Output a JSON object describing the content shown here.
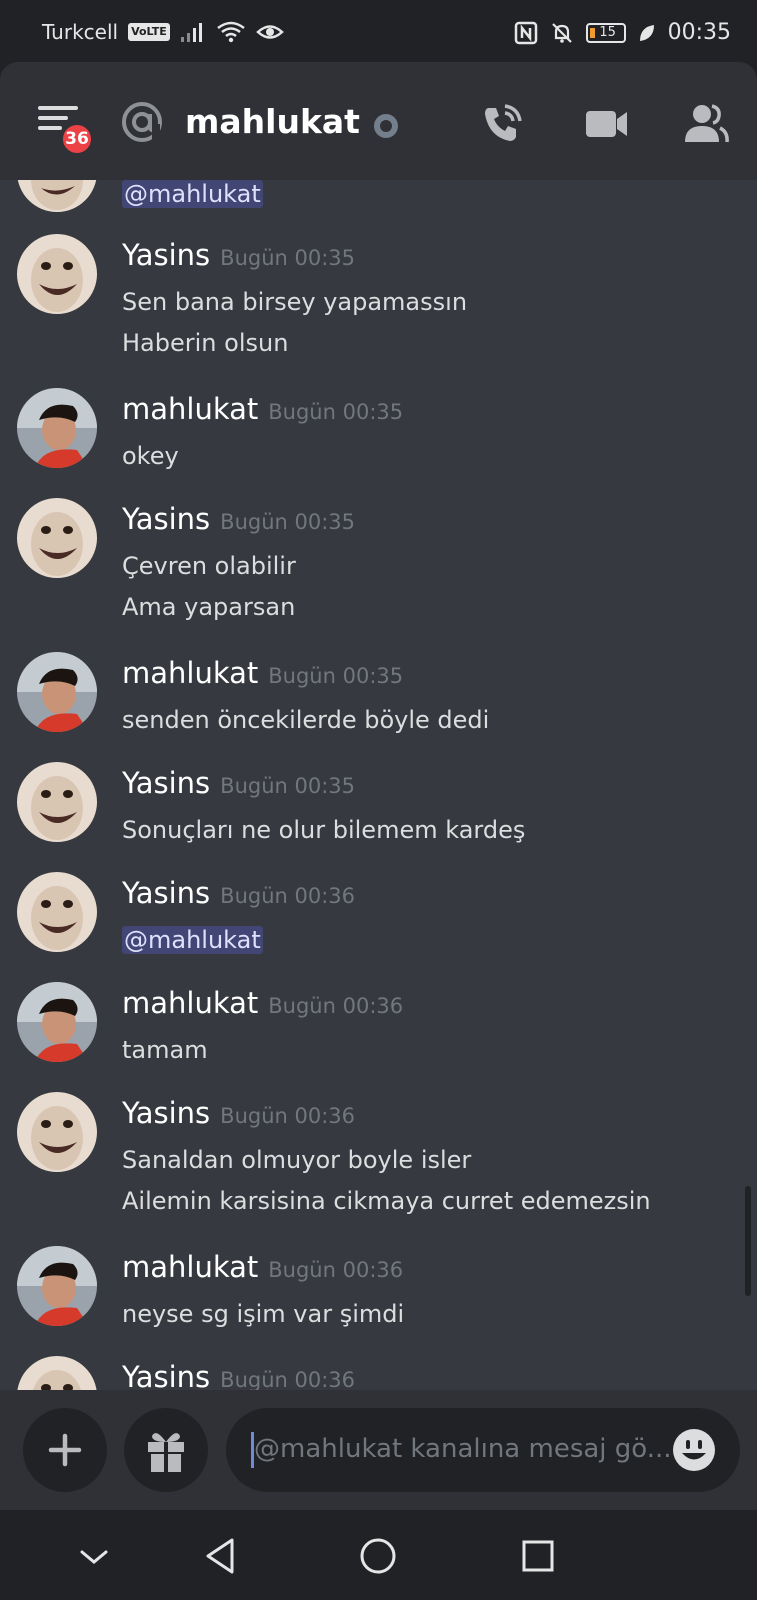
{
  "status_bar": {
    "carrier": "Turkcell",
    "volte": "VoLTE",
    "battery": "15",
    "time": "00:35"
  },
  "header": {
    "badge_count": "36",
    "channel_name": "mahlukat"
  },
  "messages": {
    "top_mention": "@mahlukat",
    "items": [
      {
        "author": "Yasins",
        "time": "Bugün 00:35",
        "lines": [
          "Sen bana birsey yapamassın",
          "Haberin olsun"
        ]
      },
      {
        "author": "mahlukat",
        "time": "Bugün 00:35",
        "lines": [
          "okey"
        ]
      },
      {
        "author": "Yasins",
        "time": "Bugün 00:35",
        "lines": [
          "Çevren olabilir",
          "Ama yaparsan"
        ]
      },
      {
        "author": "mahlukat",
        "time": "Bugün 00:35",
        "lines": [
          "senden öncekilerde böyle dedi"
        ]
      },
      {
        "author": "Yasins",
        "time": "Bugün 00:35",
        "lines": [
          "Sonuçları ne olur bilemem kardeş"
        ]
      },
      {
        "author": "Yasins",
        "time": "Bugün 00:36",
        "lines": [
          "@mahlukat"
        ]
      },
      {
        "author": "mahlukat",
        "time": "Bugün 00:36",
        "lines": [
          "tamam"
        ]
      },
      {
        "author": "Yasins",
        "time": "Bugün 00:36",
        "lines": [
          "Sanaldan olmuyor boyle isler",
          "Ailemin karsisina cikmaya curret edemezsin"
        ]
      },
      {
        "author": "mahlukat",
        "time": "Bugün 00:36",
        "lines": [
          "neyse sg işim var şimdi"
        ]
      },
      {
        "author": "Yasins",
        "time": "Bugün 00:36",
        "lines": []
      }
    ]
  },
  "composer": {
    "placeholder": "@mahlukat kanalına mesaj gö..."
  },
  "colors": {
    "background": "#36393f",
    "header": "#303136",
    "mention_bg": "#414675",
    "badge": "#ed4245",
    "timestamp": "#72767d"
  },
  "icons": [
    "menu-icon",
    "at-icon",
    "status-idle-icon",
    "voice-call-icon",
    "video-call-icon",
    "members-icon",
    "plus-icon",
    "gift-icon",
    "emoji-icon",
    "back-icon",
    "home-icon",
    "recents-icon",
    "chevron-down-icon"
  ]
}
